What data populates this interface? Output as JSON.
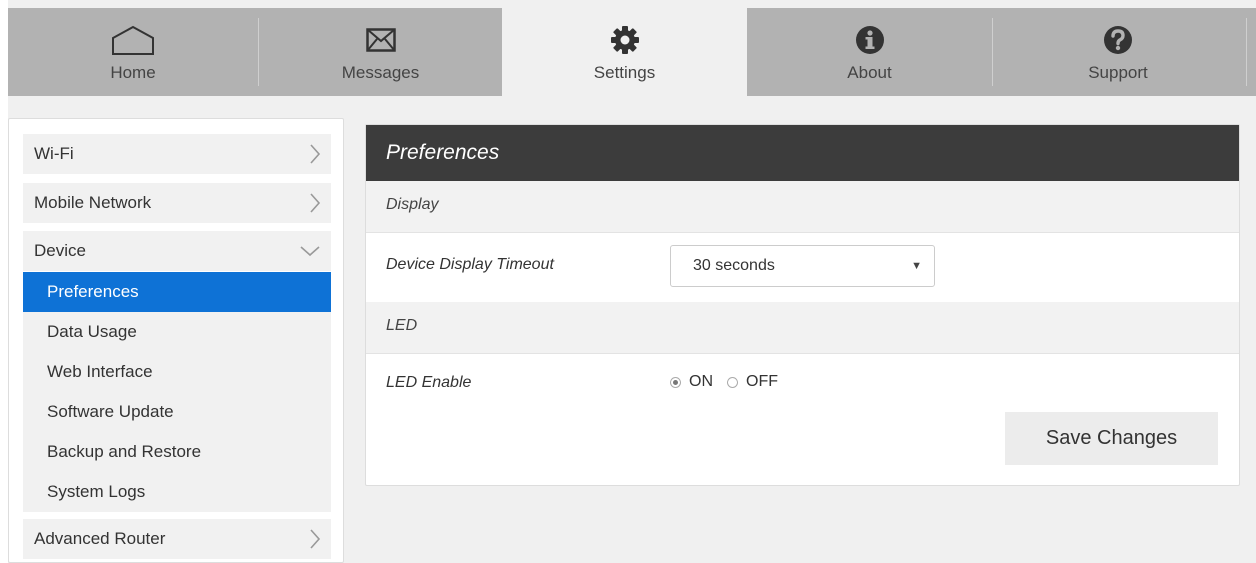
{
  "nav": {
    "tabs": [
      {
        "label": "Home",
        "icon": "home-icon"
      },
      {
        "label": "Messages",
        "icon": "envelope-icon"
      },
      {
        "label": "Settings",
        "icon": "gear-icon",
        "active": true
      },
      {
        "label": "About",
        "icon": "info-icon"
      },
      {
        "label": "Support",
        "icon": "question-icon"
      }
    ]
  },
  "sidebar": {
    "items": [
      {
        "label": "Wi-Fi",
        "chevron": "chevron-right-icon"
      },
      {
        "label": "Mobile Network",
        "chevron": "chevron-right-icon"
      },
      {
        "label": "Device",
        "chevron": "chevron-down-icon",
        "expanded": true
      },
      {
        "label": "Advanced Router",
        "chevron": "chevron-right-icon"
      }
    ],
    "device_subitems": [
      {
        "label": "Preferences",
        "selected": true
      },
      {
        "label": "Data Usage"
      },
      {
        "label": "Web Interface"
      },
      {
        "label": "Software Update"
      },
      {
        "label": "Backup and Restore"
      },
      {
        "label": "System Logs"
      }
    ]
  },
  "panel": {
    "title": "Preferences",
    "display_section": "Display",
    "timeout_label": "Device Display Timeout",
    "timeout_value": "30 seconds",
    "led_section": "LED",
    "led_label": "LED Enable",
    "led_on": "ON",
    "led_off": "OFF",
    "led_selected": "ON",
    "save_label": "Save Changes"
  },
  "colors": {
    "nav_bg": "#b2b2b2",
    "selected_item": "#0e72d6",
    "panel_header": "#3c3c3c"
  }
}
